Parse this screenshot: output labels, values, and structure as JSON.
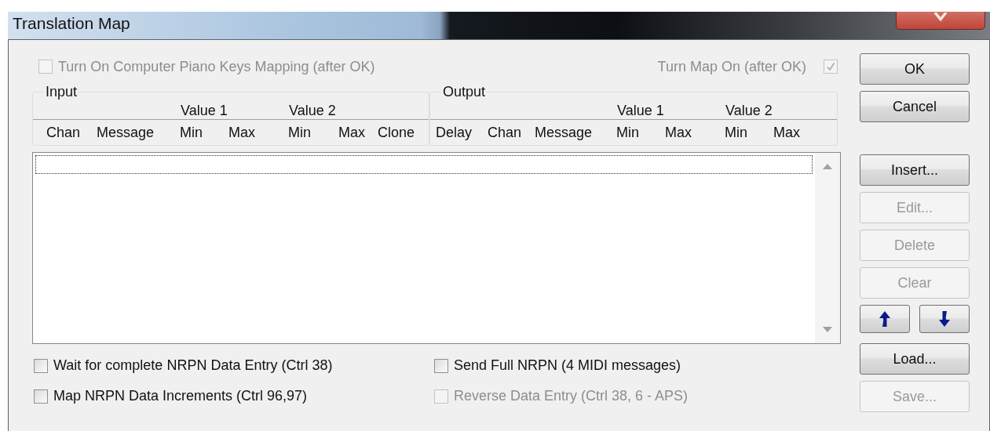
{
  "window": {
    "title": "Translation Map"
  },
  "top_options": [
    {
      "label": "Turn On Computer Piano Keys Mapping (after OK)",
      "checked": false,
      "disabled": true
    },
    {
      "label": "Turn Map On (after OK)",
      "checked": true,
      "disabled": true
    }
  ],
  "input_group": {
    "title": "Input",
    "value_headers": [
      "Value 1",
      "Value 2"
    ],
    "columns": [
      "Chan",
      "Message",
      "Min",
      "Max",
      "Min",
      "Max",
      "Clone"
    ]
  },
  "output_group": {
    "title": "Output",
    "value_headers": [
      "Value 1",
      "Value 2"
    ],
    "columns": [
      "Delay",
      "Chan",
      "Message",
      "Min",
      "Max",
      "Min",
      "Max"
    ]
  },
  "bottom_options": [
    {
      "label": "Wait for complete NRPN Data Entry (Ctrl 38)",
      "checked": false,
      "disabled": false
    },
    {
      "label": "Send Full NRPN (4 MIDI messages)",
      "checked": false,
      "disabled": false
    },
    {
      "label": "Map NRPN Data Increments (Ctrl 96,97)",
      "checked": false,
      "disabled": false
    },
    {
      "label": "Reverse Data Entry (Ctrl 38, 6 - APS)",
      "checked": false,
      "disabled": true
    }
  ],
  "buttons": [
    {
      "kind": "text",
      "label": "OK",
      "disabled": false
    },
    {
      "kind": "text",
      "label": "Cancel",
      "disabled": false
    },
    {
      "kind": "text",
      "label": "Insert...",
      "disabled": false
    },
    {
      "kind": "text",
      "label": "Edit...",
      "disabled": true
    },
    {
      "kind": "text",
      "label": "Delete",
      "disabled": true
    },
    {
      "kind": "text",
      "label": "Clear",
      "disabled": true
    },
    {
      "kind": "move-up",
      "disabled": false
    },
    {
      "kind": "move-down",
      "disabled": false
    },
    {
      "kind": "text",
      "label": "Load...",
      "disabled": false
    },
    {
      "kind": "text",
      "label": "Save...",
      "disabled": true
    }
  ]
}
